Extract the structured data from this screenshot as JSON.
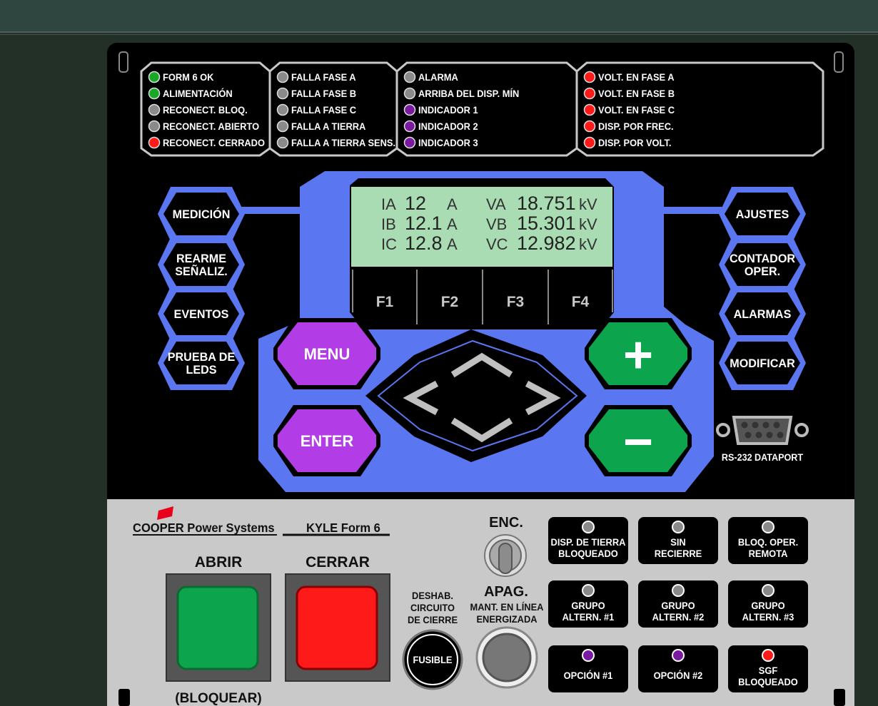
{
  "colors": {
    "blue": "#5a76f0",
    "purple": "#b23ce6",
    "green": "#0ca54e",
    "red": "#ff1a1a",
    "gray_led": "#8a8a8a",
    "led_green": "#18a828",
    "led_purple": "#7a1aa0",
    "lcd": "#a9dcb3"
  },
  "led_groups": [
    {
      "items": [
        {
          "label": "FORM 6 OK",
          "color": "green"
        },
        {
          "label": "ALIMENTACIÓN",
          "color": "green"
        },
        {
          "label": "RECONECT. BLOQ.",
          "color": "gray"
        },
        {
          "label": "RECONECT. ABIERTO",
          "color": "gray"
        },
        {
          "label": "RECONECT. CERRADO",
          "color": "red"
        }
      ]
    },
    {
      "items": [
        {
          "label": "FALLA FASE A",
          "color": "gray"
        },
        {
          "label": "FALLA FASE B",
          "color": "gray"
        },
        {
          "label": "FALLA FASE C",
          "color": "gray"
        },
        {
          "label": "FALLA A TIERRA",
          "color": "gray"
        },
        {
          "label": "FALLA A TIERRA SENS.",
          "color": "gray"
        }
      ]
    },
    {
      "items": [
        {
          "label": "ALARMA",
          "color": "gray"
        },
        {
          "label": "ARRIBA DEL DISP. MÍN",
          "color": "gray"
        },
        {
          "label": "INDICADOR 1",
          "color": "purple"
        },
        {
          "label": "INDICADOR 2",
          "color": "purple"
        },
        {
          "label": "INDICADOR 3",
          "color": "purple"
        }
      ]
    },
    {
      "items": [
        {
          "label": "VOLT. EN FASE A",
          "color": "red"
        },
        {
          "label": "VOLT. EN FASE B",
          "color": "red"
        },
        {
          "label": "VOLT. EN FASE C",
          "color": "red"
        },
        {
          "label": "DISP. POR FREC.",
          "color": "red"
        },
        {
          "label": "DISP. POR VOLT.",
          "color": "red"
        }
      ]
    }
  ],
  "lcd": {
    "rows": [
      {
        "cl": "IA",
        "cv": "12",
        "cu": "A",
        "vl": "VA",
        "vv": "18.751",
        "vu": "kV"
      },
      {
        "cl": "IB",
        "cv": "12.1",
        "cu": "A",
        "vl": "VB",
        "vv": "15.301",
        "vu": "kV"
      },
      {
        "cl": "IC",
        "cv": "12.8",
        "cu": "A",
        "vl": "VC",
        "vv": "12.982",
        "vu": "kV"
      }
    ]
  },
  "fkeys": [
    "F1",
    "F2",
    "F3",
    "F4"
  ],
  "left_buttons": [
    [
      "MEDICIÓN"
    ],
    [
      "REARME",
      "SEÑALIZ."
    ],
    [
      "EVENTOS"
    ],
    [
      "PRUEBA DE",
      "LEDS"
    ]
  ],
  "right_buttons": [
    [
      "AJUSTES"
    ],
    [
      "CONTADOR",
      "OPER."
    ],
    [
      "ALARMAS"
    ],
    [
      "MODIFICAR"
    ]
  ],
  "menu_label": "MENU",
  "enter_label": "ENTER",
  "plus_label": "+",
  "minus_label": "−",
  "dataport_label": "RS-232 DATAPORT",
  "brand": "COOPER Power Systems",
  "model": "KYLE Form 6",
  "abrir_label": "ABRIR",
  "abrir_sub": "(BLOQUEAR)",
  "cerrar_label": "CERRAR",
  "toggle_on": "ENC.",
  "toggle_off": "APAG.",
  "fuse_caption": [
    "DESHAB.",
    "CIRCUITO",
    "DE CIERRE"
  ],
  "fuse_label": "FUSIBLE",
  "hotline_caption": [
    "MANT. EN LÍNEA",
    "ENERGIZADA"
  ],
  "options": [
    {
      "lines": [
        "DISP. DE TIERRA",
        "BLOQUEADO"
      ],
      "led": "gray"
    },
    {
      "lines": [
        "SIN",
        "RECIERRE"
      ],
      "led": "gray"
    },
    {
      "lines": [
        "BLOQ. OPER.",
        "REMOTA"
      ],
      "led": "gray"
    },
    {
      "lines": [
        "GRUPO",
        "ALTERN. #1"
      ],
      "led": "gray"
    },
    {
      "lines": [
        "GRUPO",
        "ALTERN. #2"
      ],
      "led": "gray"
    },
    {
      "lines": [
        "GRUPO",
        "ALTERN. #3"
      ],
      "led": "gray"
    },
    {
      "lines": [
        "OPCIÓN #1"
      ],
      "led": "purple"
    },
    {
      "lines": [
        "OPCIÓN #2"
      ],
      "led": "purple"
    },
    {
      "lines": [
        "SGF",
        "BLOQUEADO"
      ],
      "led": "red"
    }
  ]
}
